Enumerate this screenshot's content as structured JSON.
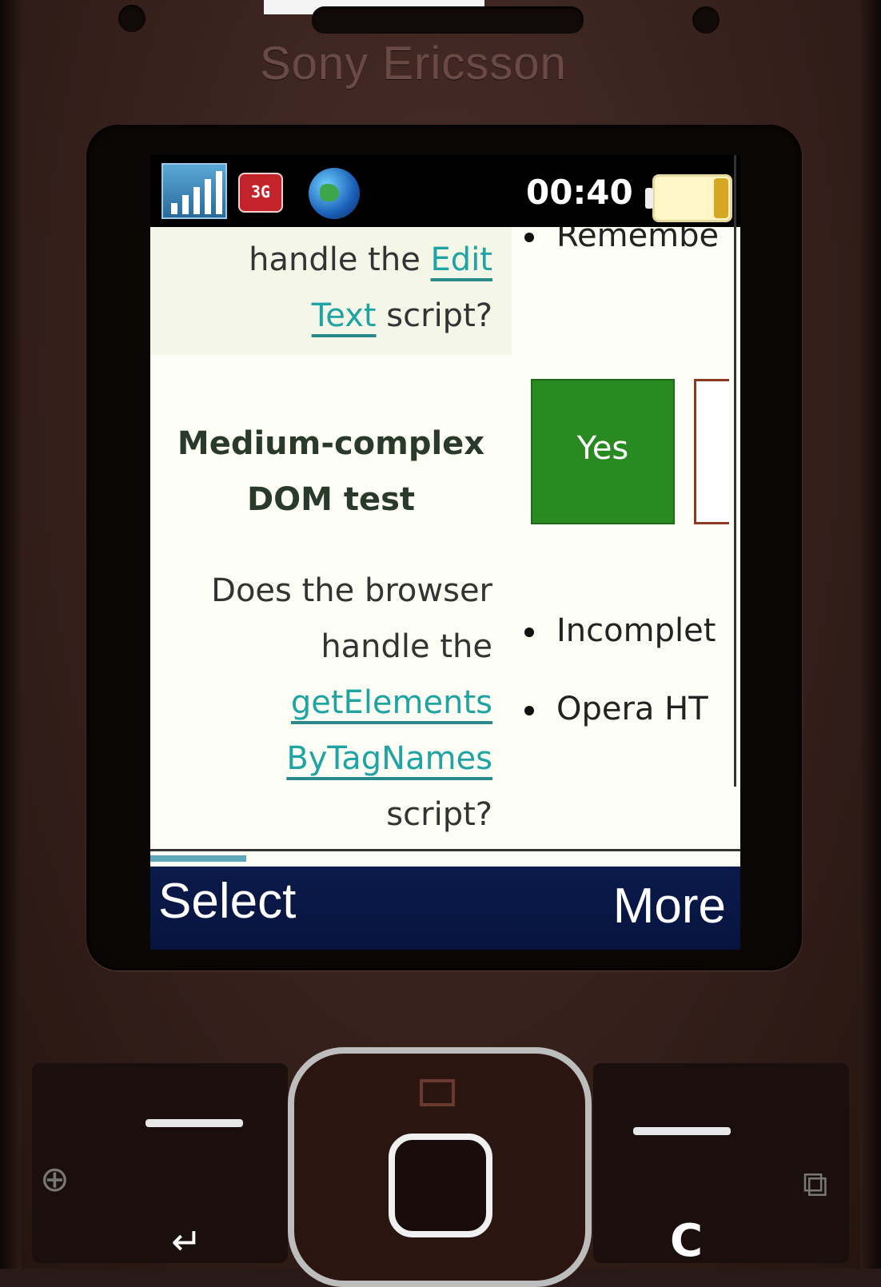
{
  "device": {
    "brand": "Sony Ericsson"
  },
  "statusbar": {
    "signal_icon": "signal-strength-icon",
    "network_icon": "3g-icon",
    "network_label": "3G",
    "browser_icon": "globe-icon",
    "time": "00:40",
    "battery_icon": "battery-icon"
  },
  "page": {
    "question1_line1_prefix": "handle the ",
    "question1_link_part1": "Edit",
    "question1_link_part2": "Text",
    "question1_suffix": " script?",
    "test_title_line1": "Medium-complex",
    "test_title_line2": "DOM test",
    "question2_line1": "Does the browser",
    "question2_line2": "handle the",
    "question2_link_line1": "getElements",
    "question2_link_line2": "ByTagNames",
    "question2_suffix": "script?",
    "answer_yes": "Yes",
    "bullets": {
      "remember": "Remembe",
      "incomplete": "Incomplet",
      "opera": "Opera HT"
    }
  },
  "softkeys": {
    "left": "Select",
    "right": "More"
  },
  "keypad": {
    "clear_key": "C",
    "back_key": "↵"
  }
}
